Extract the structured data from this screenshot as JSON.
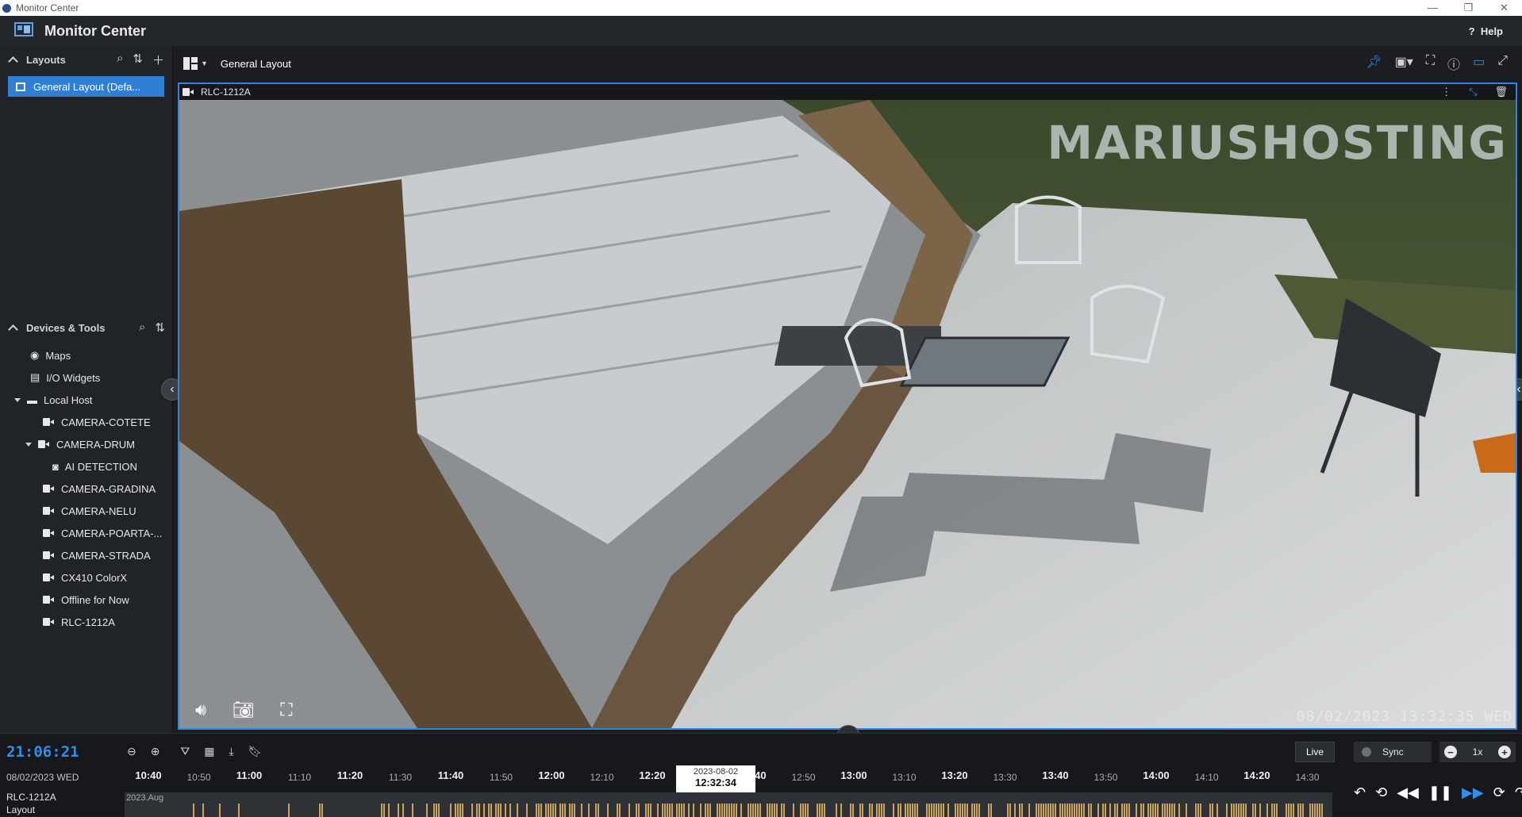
{
  "window": {
    "title": "Monitor Center",
    "controls": [
      "—",
      "❐",
      "✕"
    ]
  },
  "header": {
    "app_name": "Monitor Center",
    "help_label": "Help"
  },
  "sidebar": {
    "layouts_title": "Layouts",
    "layout_item": "General Layout (Defa...",
    "devices_title": "Devices & Tools",
    "tree": [
      {
        "label": "Maps",
        "icon": "map-icon",
        "level": 0
      },
      {
        "label": "I/O Widgets",
        "icon": "io-widget-icon",
        "level": 0
      },
      {
        "label": "Local Host",
        "icon": "host-icon",
        "level": 0,
        "expanded": true
      },
      {
        "label": "CAMERA-COTETE",
        "icon": "camera-icon",
        "level": 1
      },
      {
        "label": "CAMERA-DRUM",
        "icon": "camera-icon",
        "level": 1,
        "expanded": true
      },
      {
        "label": "AI DETECTION",
        "icon": "ai-detection-icon",
        "level": 2
      },
      {
        "label": "CAMERA-GRADINA",
        "icon": "camera-icon",
        "level": 1
      },
      {
        "label": "CAMERA-NELU",
        "icon": "camera-icon",
        "level": 1
      },
      {
        "label": "CAMERA-POARTA-...",
        "icon": "camera-icon",
        "level": 1
      },
      {
        "label": "CAMERA-STRADA",
        "icon": "camera-icon",
        "level": 1
      },
      {
        "label": "CX410 ColorX",
        "icon": "camera-icon",
        "level": 1
      },
      {
        "label": "Offline for Now",
        "icon": "camera-icon",
        "level": 1
      },
      {
        "label": "RLC-1212A",
        "icon": "camera-icon",
        "level": 1
      }
    ]
  },
  "toolbar": {
    "layout_name": "General Layout"
  },
  "panel": {
    "camera_name": "RLC-1212A",
    "watermark": "MARIUSHOSTING",
    "timestamp": "08/02/2023 13:32:35 WED"
  },
  "timeline": {
    "clock": "21:06:21",
    "date": "08/02/2023 WED",
    "live_label": "Live",
    "sync_label": "Sync",
    "speed": "1x",
    "cursor_date": "2023-08-02",
    "cursor_time": "12:32:34",
    "month_label": "2023.Aug",
    "track_labels": [
      "RLC-1212A",
      "Layout"
    ],
    "ticks": [
      {
        "label": "10:40",
        "major": true
      },
      {
        "label": "10:50",
        "major": false
      },
      {
        "label": "11:00",
        "major": true
      },
      {
        "label": "11:10",
        "major": false
      },
      {
        "label": "11:20",
        "major": true
      },
      {
        "label": "11:30",
        "major": false
      },
      {
        "label": "11:40",
        "major": true
      },
      {
        "label": "11:50",
        "major": false
      },
      {
        "label": "12:00",
        "major": true
      },
      {
        "label": "12:10",
        "major": false
      },
      {
        "label": "12:20",
        "major": true
      },
      {
        "label": "12:30",
        "major": false
      },
      {
        "label": "12:40",
        "major": true
      },
      {
        "label": "12:50",
        "major": false
      },
      {
        "label": "13:00",
        "major": true
      },
      {
        "label": "13:10",
        "major": false
      },
      {
        "label": "13:20",
        "major": true
      },
      {
        "label": "13:30",
        "major": false
      },
      {
        "label": "13:40",
        "major": true
      },
      {
        "label": "13:50",
        "major": false
      },
      {
        "label": "14:00",
        "major": true
      },
      {
        "label": "14:10",
        "major": false
      },
      {
        "label": "14:20",
        "major": true
      },
      {
        "label": "14:30",
        "major": false
      }
    ]
  },
  "colors": {
    "accent": "#2f8fe8",
    "recording": "#c9a45a",
    "panel_border": "#2f86e0"
  }
}
